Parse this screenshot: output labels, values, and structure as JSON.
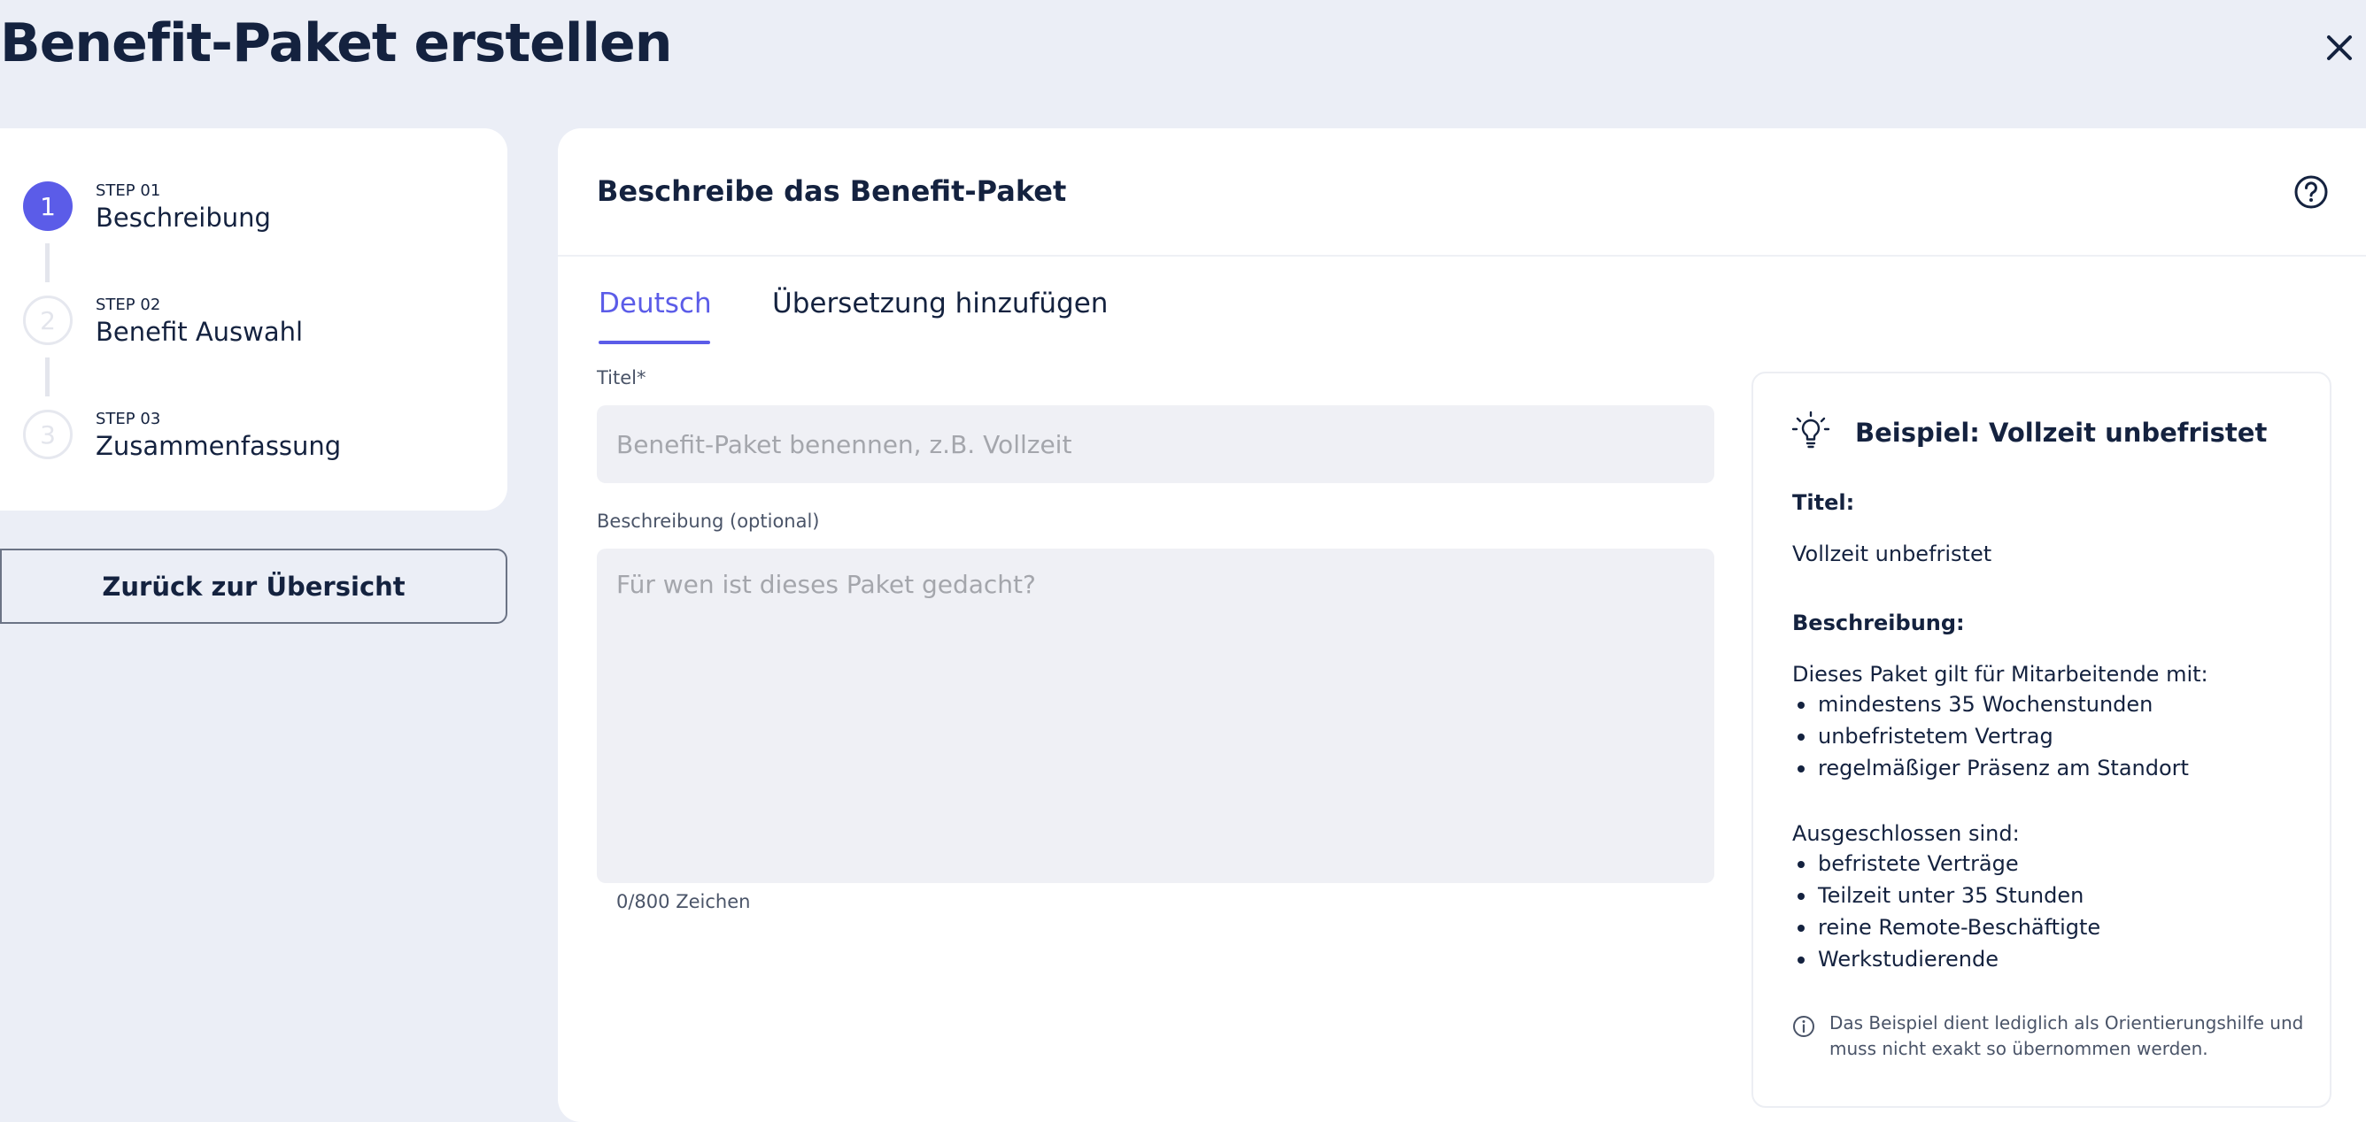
{
  "page": {
    "title": "Benefit-Paket erstellen"
  },
  "stepper": {
    "steps": [
      {
        "number": "1",
        "small": "STEP 01",
        "label": "Beschreibung",
        "active": true
      },
      {
        "number": "2",
        "small": "STEP 02",
        "label": "Benefit Auswahl",
        "active": false
      },
      {
        "number": "3",
        "small": "STEP 03",
        "label": "Zusammenfassung",
        "active": false
      }
    ],
    "back_label": "Zurück zur Übersicht"
  },
  "main": {
    "title": "Beschreibe das Benefit-Paket",
    "tabs": [
      {
        "label": "Deutsch",
        "active": true
      },
      {
        "label": "Übersetzung hinzufügen",
        "active": false
      }
    ],
    "title_field": {
      "label": "Titel*",
      "value": "",
      "placeholder": "Benefit-Paket benennen, z.B. Vollzeit"
    },
    "description_field": {
      "label": "Beschreibung (optional)",
      "value": "",
      "placeholder": "Für wen ist dieses Paket gedacht?"
    },
    "char_count": "0/800 Zeichen"
  },
  "example": {
    "title": "Beispiel: Vollzeit unbefristet",
    "title_heading": "Titel:",
    "title_value": "Vollzeit unbefristet",
    "description_heading": "Beschreibung:",
    "intro": "Dieses Paket gilt für Mitarbeitende mit:",
    "included": [
      "mindestens 35 Wochenstunden",
      "unbefristetem Vertrag",
      "regelmäßiger Präsenz am Standort"
    ],
    "excluded_heading": "Ausgeschlossen sind:",
    "excluded": [
      "befristete Verträge",
      "Teilzeit unter 35 Stunden",
      "reine Remote-Beschäftigte",
      "Werkstudierende"
    ],
    "note": "Das Beispiel dient lediglich als Orientierungshilfe und muss nicht exakt so übernommen werden."
  },
  "icons": {
    "close": "close-icon",
    "help": "question-circle-icon",
    "bulb": "lightbulb-icon",
    "info": "info-circle-icon"
  },
  "colors": {
    "accent": "#5b5ce8",
    "text": "#14223f",
    "background": "#ebeef6",
    "input_bg": "#eff0f5"
  }
}
